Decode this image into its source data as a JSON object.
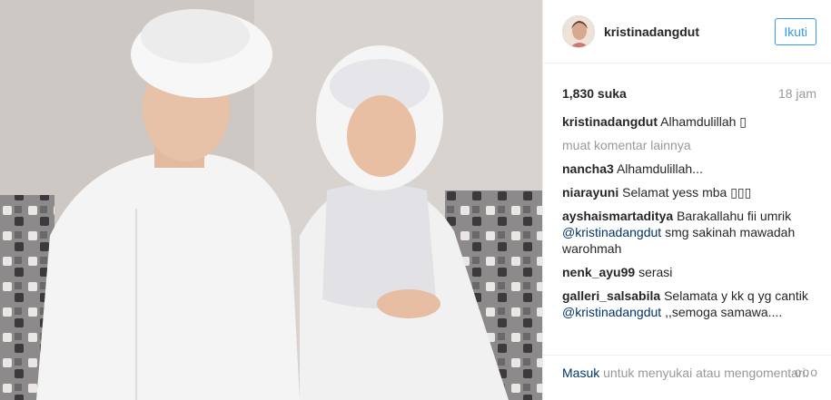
{
  "post": {
    "username": "kristinadangdut",
    "follow_label": "Ikuti",
    "likes": "1,830 suka",
    "time": "18 jam",
    "caption_user": "kristinadangdut",
    "caption_text": "Alhamdulillah ▯",
    "load_more": "muat komentar lainnya",
    "comments": [
      {
        "user": "nancha3",
        "text": "Alhamdulillah..."
      },
      {
        "user": "niarayuni",
        "text": "Selamat yess mba ▯▯▯"
      },
      {
        "user": "ayshaismartaditya",
        "text_before": "Barakallahu fii umrik",
        "mention": "@kristinadangdut",
        "text_after": "smg sakinah mawadah warohmah"
      },
      {
        "user": "nenk_ayu99",
        "text": "serasi"
      },
      {
        "user": "galleri_salsabila",
        "text_before": "Selamata y kk q yg cantik",
        "mention": "@kristinadangdut",
        "text_after": ",,semoga samawa...."
      }
    ],
    "footer_login": "Masuk",
    "footer_text": "untuk menyukai atau mengomentari.",
    "more_options": "ooo"
  },
  "colors": {
    "accent": "#3897f0",
    "link": "#003569",
    "muted": "#999999"
  }
}
